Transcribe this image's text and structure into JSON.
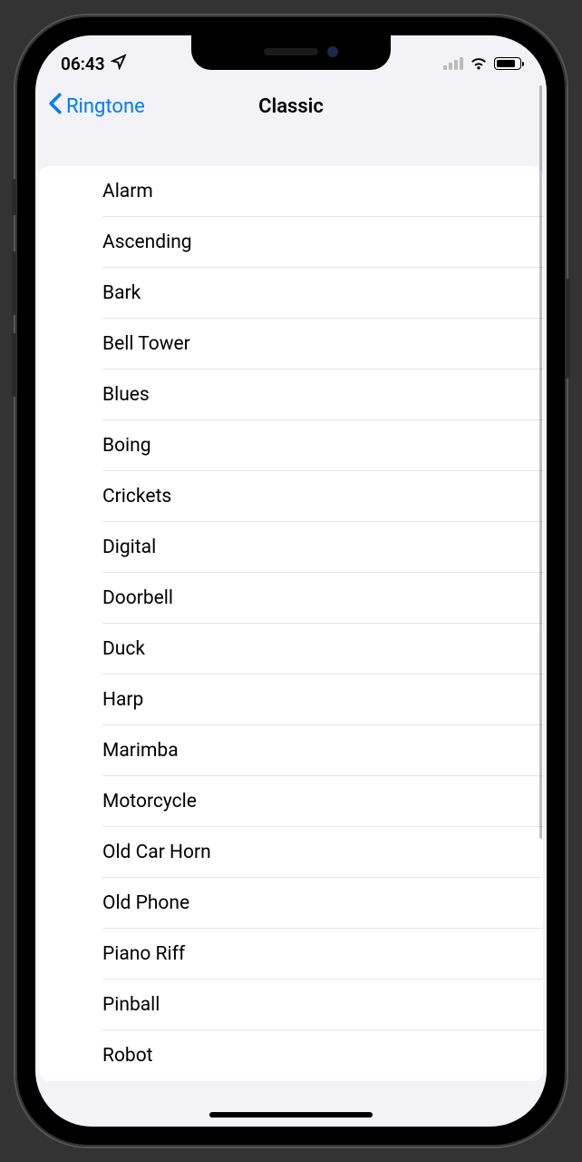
{
  "status": {
    "time": "06:43"
  },
  "nav": {
    "back_label": "Ringtone",
    "title": "Classic"
  },
  "ringtones": [
    {
      "label": "Alarm"
    },
    {
      "label": "Ascending"
    },
    {
      "label": "Bark"
    },
    {
      "label": "Bell Tower"
    },
    {
      "label": "Blues"
    },
    {
      "label": "Boing"
    },
    {
      "label": "Crickets"
    },
    {
      "label": "Digital"
    },
    {
      "label": "Doorbell"
    },
    {
      "label": "Duck"
    },
    {
      "label": "Harp"
    },
    {
      "label": "Marimba"
    },
    {
      "label": "Motorcycle"
    },
    {
      "label": "Old Car Horn"
    },
    {
      "label": "Old Phone"
    },
    {
      "label": "Piano Riff"
    },
    {
      "label": "Pinball"
    },
    {
      "label": "Robot"
    }
  ]
}
